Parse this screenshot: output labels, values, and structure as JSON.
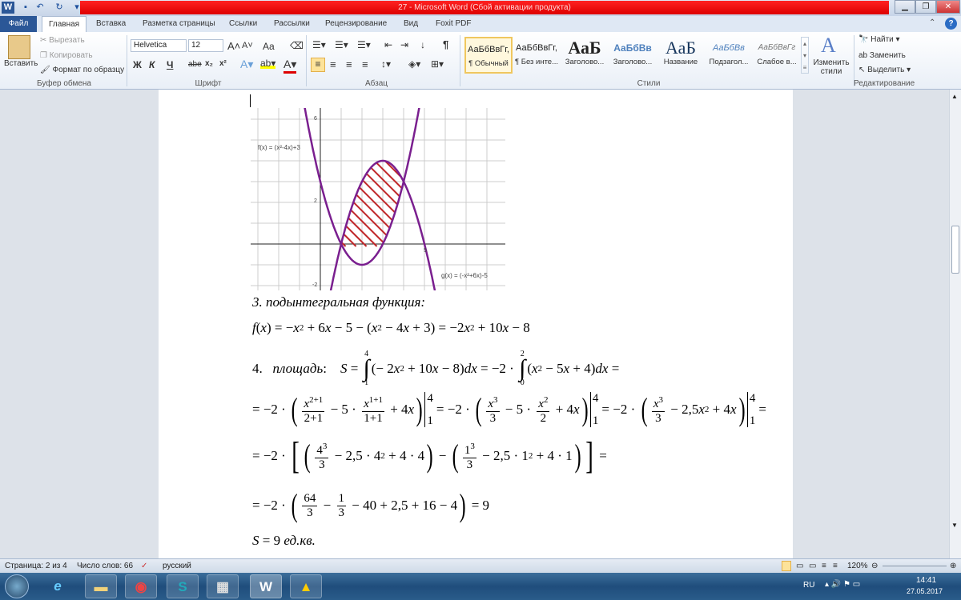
{
  "window": {
    "title": "27  -  Microsoft Word (Сбой активации продукта)",
    "app_icon": "W"
  },
  "quick_access": {
    "save": "save-icon",
    "undo": "undo-icon",
    "redo": "redo-icon"
  },
  "tabs": [
    "Файл",
    "Главная",
    "Вставка",
    "Разметка страницы",
    "Ссылки",
    "Рассылки",
    "Рецензирование",
    "Вид",
    "Foxit PDF"
  ],
  "clipboard": {
    "paste": "Вставить",
    "cut": "Вырезать",
    "copy": "Копировать",
    "format_painter": "Формат по образцу",
    "group": "Буфер обмена"
  },
  "font": {
    "name": "Helvetica",
    "size": "12",
    "bold": "Ж",
    "italic": "К",
    "underline": "Ч",
    "strike": "abe",
    "sub": "x₂",
    "sup": "x²",
    "grow": "A˄",
    "shrink": "A˅",
    "case": "Aa",
    "group": "Шрифт"
  },
  "paragraph": {
    "group": "Абзац",
    "pilcrow": "¶"
  },
  "styles": {
    "group": "Стили",
    "items": [
      {
        "preview": "АаБбВвГг,",
        "name": "¶ Обычный"
      },
      {
        "preview": "АаБбВвГг,",
        "name": "¶ Без инте..."
      },
      {
        "preview": "АаБ",
        "name": "Заголово..."
      },
      {
        "preview": "АаБбВв",
        "name": "Заголово..."
      },
      {
        "preview": "АаБ",
        "name": "Название"
      },
      {
        "preview": "АаБбВв",
        "name": "Подзагол..."
      },
      {
        "preview": "АаБбВвГг",
        "name": "Слабое в..."
      }
    ],
    "change": "Изменить стили"
  },
  "editing": {
    "group": "Редактирование",
    "find": "Найти",
    "replace": "Заменить",
    "select": "Выделить"
  },
  "graph": {
    "f_label": "f(x) = (x²-4x)+3",
    "g_label": "g(x) = (-x²+6x)-5",
    "ticks": {
      "y6": "6",
      "y2": "2",
      "yn2": "-2",
      "x5": "5"
    },
    "curve_color": "#7a1f8f",
    "hatch_color": "#c0282a",
    "x_range": [
      -3.4,
      8.8
    ],
    "y_range": [
      -2.2,
      6.5
    ]
  },
  "doc": {
    "step3": "3.   подынтегральная функция:",
    "lines": [
      [
        {
          "i": "f"
        },
        "(",
        {
          "i": "x"
        },
        ") = −",
        {
          "i": "x"
        },
        {
          "sup": "2"
        },
        " + 6",
        {
          "i": "x"
        },
        " − 5 − (",
        {
          "i": "x"
        },
        {
          "sup": "2"
        },
        " − 4",
        {
          "i": "x"
        },
        " + 3) = −2",
        {
          "i": "x"
        },
        {
          "sup": "2"
        },
        " + 10",
        {
          "i": "x"
        },
        " − 8"
      ],
      [
        "4.   ",
        {
          "i": "площадь"
        },
        ":    ",
        {
          "i": "S"
        },
        " = ",
        {
          "int": [
            "4",
            "1"
          ]
        },
        "(− 2",
        {
          "i": "x"
        },
        {
          "sup": "2"
        },
        " + 10",
        {
          "i": "x"
        },
        " − 8)",
        {
          "i": "dx"
        },
        " = −2 · ",
        {
          "int": [
            "2",
            "0"
          ]
        },
        "(",
        {
          "i": "x"
        },
        {
          "sup": "2"
        },
        " − 5",
        {
          "i": "x"
        },
        " + 4)",
        {
          "i": "dx"
        },
        " ="
      ],
      [
        "= −2 · ",
        {
          "bp": "("
        },
        {
          "fr": [
            "x^2+1",
            "2+1"
          ]
        },
        " − 5 · ",
        {
          "fr": [
            "x^1+1",
            "1+1"
          ]
        },
        " + 4",
        {
          "i": "x"
        },
        {
          "bp": ")"
        },
        {
          "bar": [
            "4",
            "1"
          ]
        },
        "= −2 · ",
        {
          "bp": "("
        },
        {
          "fr": [
            "x^3",
            "3"
          ]
        },
        " − 5 · ",
        {
          "fr": [
            "x^2",
            "2"
          ]
        },
        " + 4",
        {
          "i": "x"
        },
        {
          "bp": ")"
        },
        {
          "bar": [
            "4",
            "1"
          ]
        },
        "= −2 · ",
        {
          "bp": "("
        },
        {
          "fr": [
            "x^3",
            "3"
          ]
        },
        " − 2,5",
        {
          "i": "x"
        },
        {
          "sup": "2"
        },
        " + 4",
        {
          "i": "x"
        },
        {
          "bp": ")"
        },
        {
          "bar": [
            "4",
            "1"
          ]
        },
        "="
      ],
      [
        "= −2 · ",
        {
          "bpx": "["
        },
        {
          "bp": "("
        },
        {
          "fr": [
            "4^3",
            "3"
          ]
        },
        " − 2,5 · 4",
        {
          "sup": "2"
        },
        " + 4 · 4",
        {
          "bp": ")"
        },
        " − ",
        {
          "bp": "("
        },
        {
          "fr": [
            "1^3",
            "3"
          ]
        },
        " − 2,5 · 1",
        {
          "sup": "2"
        },
        " + 4 · 1",
        {
          "bp": ")"
        },
        {
          "bpx": "]"
        },
        " ="
      ],
      [
        "= −2 · ",
        {
          "bp": "("
        },
        {
          "fr": [
            "64",
            "3"
          ]
        },
        " − ",
        {
          "fr": [
            "1",
            "3"
          ]
        },
        " − 40 + 2,5 + 16 − 4",
        {
          "bp": ")"
        },
        " = 9"
      ],
      [
        {
          "i": "S"
        },
        " = 9 ",
        {
          "i": "ед.кв."
        }
      ]
    ]
  },
  "status": {
    "page": "Страница: 2 из 4",
    "words": "Число слов: 66",
    "lang": "русский",
    "zoom": "120%"
  },
  "tray": {
    "lang": "RU",
    "time": "14:41",
    "date": "27.05.2017"
  }
}
